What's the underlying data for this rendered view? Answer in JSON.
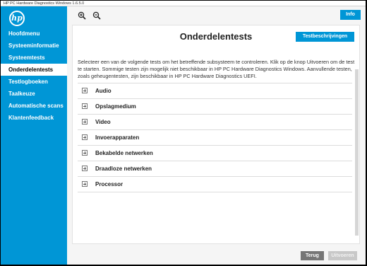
{
  "window": {
    "title": "HP PC Hardware Diagnostics Windows 1.6.5.0"
  },
  "logo": {
    "text": "hp"
  },
  "sidebar": {
    "items": [
      {
        "label": "Hoofdmenu",
        "active": false
      },
      {
        "label": "Systeeminformatie",
        "active": false
      },
      {
        "label": "Systeemtests",
        "active": false
      },
      {
        "label": "Onderdelentests",
        "active": true
      },
      {
        "label": "Testlogboeken",
        "active": false
      },
      {
        "label": "Taalkeuze",
        "active": false
      },
      {
        "label": "Automatische scans",
        "active": false
      },
      {
        "label": "Klantenfeedback",
        "active": false
      }
    ]
  },
  "toolbar": {
    "zoom_in_icon": "zoom-in-icon",
    "zoom_out_icon": "zoom-out-icon",
    "info_label": "Info"
  },
  "main": {
    "title": "Onderdelentests",
    "descriptions_button": "Testbeschrijvingen",
    "description": "Selecteer een van de volgende tests om het betreffende subsysteem te controleren. Klik op de knop Uitvoeren om de test te starten. Sommige testen zijn mogelijk niet beschikbaar in HP PC Hardware Diagnostics Windows. Aanvullende testen, zoals geheugentesten, zijn beschikbaar in HP PC Hardware Diagnostics UEFI.",
    "components": [
      "Audio",
      "Opslagmedium",
      "Video",
      "Invoerapparaten",
      "Bekabelde netwerken",
      "Draadloze netwerken",
      "Processor"
    ]
  },
  "footer": {
    "back_label": "Terug",
    "run_label": "Uitvoeren"
  },
  "colors": {
    "accent": "#0096d6",
    "back_button": "#767676",
    "disabled_button": "#c8c8c8"
  }
}
